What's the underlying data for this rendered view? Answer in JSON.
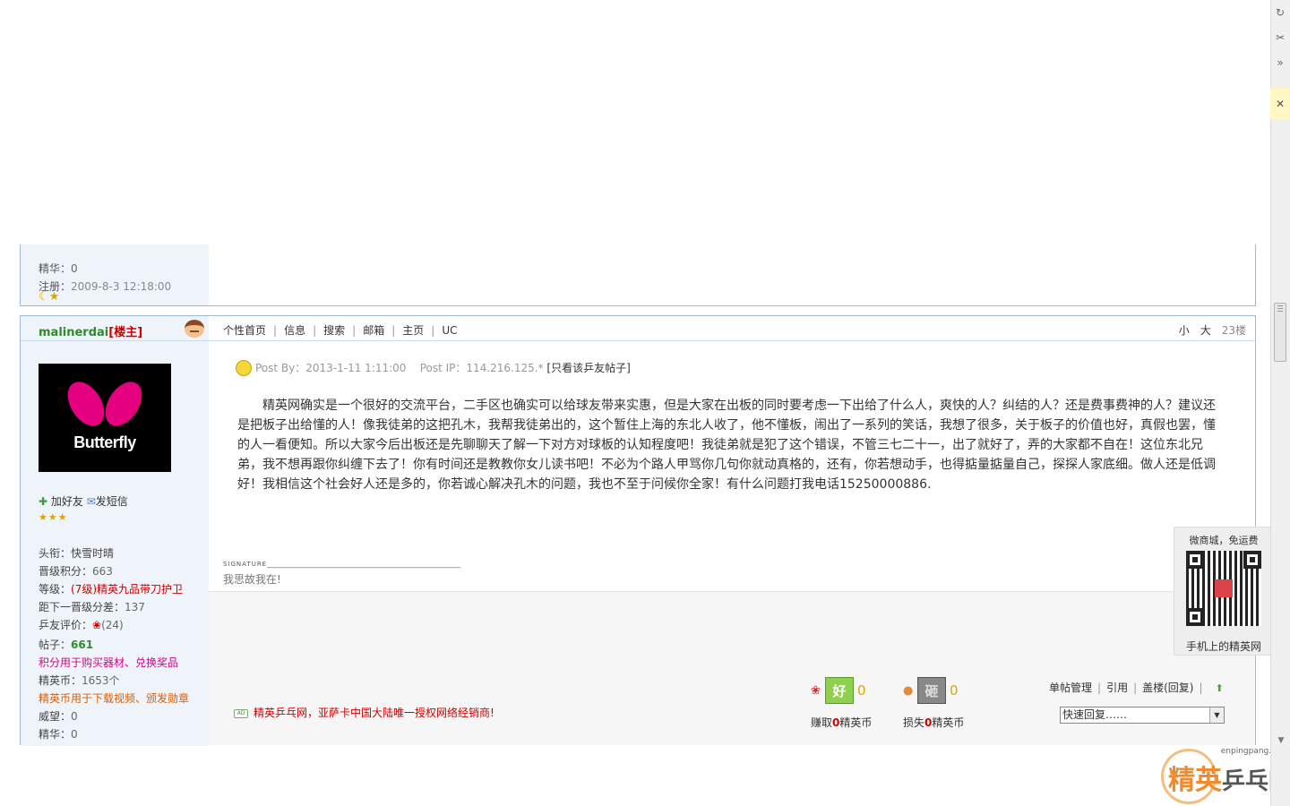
{
  "top_post": {
    "essence_label": "精华：",
    "essence_value": "0",
    "register_label": "注册：",
    "register_value": "2009-8-3 12:18:00",
    "level_icons": "☾★"
  },
  "post": {
    "username": "malinerdai",
    "role": "[楼主]",
    "nav": [
      "个性首页",
      "信息",
      "搜索",
      "邮箱",
      "主页",
      "UC"
    ],
    "size_small": "小",
    "size_large": "大",
    "floor": "23楼",
    "avatar_brand": "Butterfly",
    "add_friend": "加好友",
    "send_message": "发短信",
    "stars": "★★★",
    "info": {
      "title_label": "头衔：",
      "title_value": "快雪时晴",
      "points_label": "晋级积分：",
      "points_value": "663",
      "grade_label": "等级：",
      "grade_value": "(7级)精英九品带刀护卫",
      "next_label": "距下一晋级分差：",
      "next_value": "137",
      "rating_label": "乒友评价：",
      "rating_value": "(24)",
      "posts_label": "帖子：",
      "posts_value": "661",
      "points_note": "积分用于购买器材、兑换奖品",
      "coins_label": "精英币：",
      "coins_value": "1653个",
      "coins_note": "精英币用于下载视频、颁发勋章",
      "prestige_label": "威望：",
      "prestige_value": "0",
      "essence_label": "精华：",
      "essence_value": "0"
    },
    "post_by_label": "Post By：",
    "post_time": "2013-1-11 1:11:00",
    "post_ip_label": "Post IP：",
    "post_ip": "114.216.125.*",
    "only_view": "[只看该乒友帖子]",
    "body": "精英网确实是一个很好的交流平台，二手区也确实可以给球友带来实惠，但是大家在出板的同时要考虑一下出给了什么人，爽快的人？纠结的人？还是费事费神的人？建议还是把板子出给懂的人！像我徒弟的这把孔木，我帮我徒弟出的，这个暂住上海的东北人收了，他不懂板，闹出了一系列的笑话，我想了很多，关于板子的价值也好，真假也罢，懂的人一看便知。所以大家今后出板还是先聊聊天了解一下对方对球板的认知程度吧！我徒弟就是犯了这个错误，不管三七二十一，出了就好了，弄的大家都不自在！这位东北兄弟，我不想再跟你纠缠下去了！你有时间还是教教你女儿读书吧！不必为个路人甲骂你几句你就动真格的，还有，你若想动手，也得掂量掂量自己，探探人家底细。做人还是低调好！我相信这个社会好人还是多的，你若诚心解决孔木的问题，我也不至于问候你全家！有什么问题打我电话15250000886.",
    "signature_label": "SIGNATURE",
    "signature_dashes": "________________________________________________",
    "signature_text": "我思故我在!",
    "ad_badge": "AD",
    "ad_text": "精英乒乓网，亚萨卡中国大陆唯一授权网络经销商!",
    "good_icon": "好",
    "good_count": "0",
    "good_label_pre": "赚取",
    "good_label_num": "0",
    "good_label_post": "精英币",
    "bad_icon": "砸",
    "bad_count": "0",
    "bad_label_pre": "损失",
    "bad_label_num": "0",
    "bad_label_post": "精英币",
    "manage": [
      "单帖管理",
      "引用",
      "盖楼(回复)"
    ],
    "quick_reply": "快速回复……"
  },
  "qr_widget": {
    "title": "微商城，免运费",
    "footer": "手机上的精英网"
  },
  "site_logo": {
    "url": "enpingpang.info",
    "text1": "精英",
    "text2": "乒乓网"
  },
  "colors": {
    "border": "#9dbbd6",
    "sidebar_bg": "#eef4fa",
    "username": "#2f8a2f",
    "accent_red": "#cc0000"
  }
}
